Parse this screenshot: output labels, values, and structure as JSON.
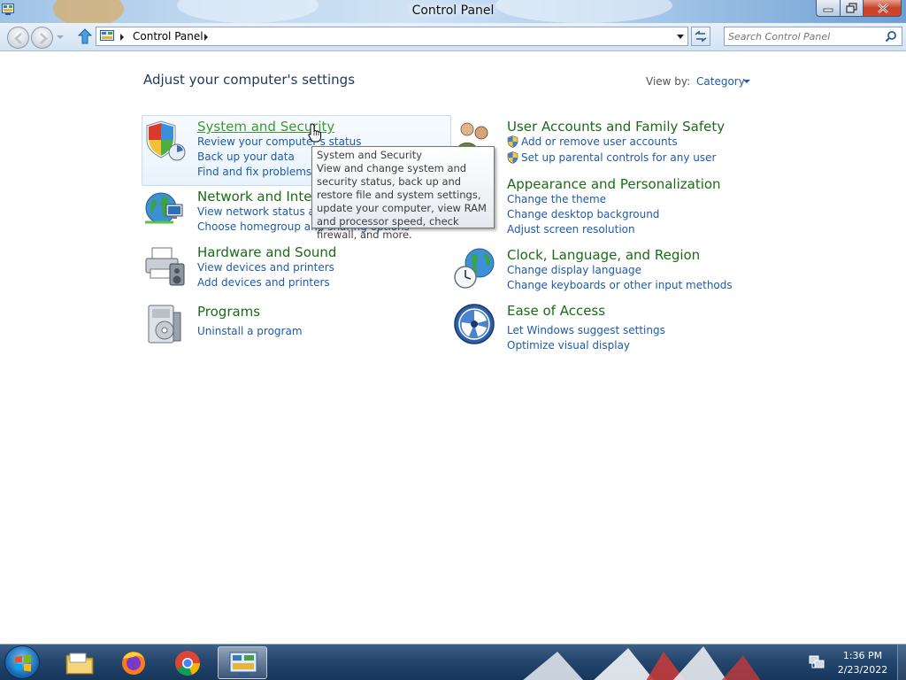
{
  "window": {
    "title": "Control Panel"
  },
  "address": {
    "breadcrumb": "Control Panel",
    "search_placeholder": "Search Control Panel"
  },
  "main": {
    "heading": "Adjust your computer's settings",
    "view_by_label": "View by:",
    "view_by_value": "Category",
    "categories": [
      {
        "title": "System and Security",
        "icon": "shield-icon",
        "links": [
          "Review your computer's status",
          "Back up your data",
          "Find and fix problems"
        ]
      },
      {
        "title": "Network and Internet",
        "icon": "network-globe-icon",
        "links": [
          "View network status and tasks",
          "Choose homegroup and sharing options"
        ]
      },
      {
        "title": "Hardware and Sound",
        "icon": "printer-speaker-icon",
        "links": [
          "View devices and printers",
          "Add devices and printers"
        ]
      },
      {
        "title": "Programs",
        "icon": "programs-icon",
        "links": [
          "Uninstall a program"
        ]
      },
      {
        "title": "User Accounts and Family Safety",
        "icon": "users-icon",
        "links": [
          "Add or remove user accounts",
          "Set up parental controls for any user"
        ]
      },
      {
        "title": "Appearance and Personalization",
        "icon": "appearance-icon",
        "links": [
          "Change the theme",
          "Change desktop background",
          "Adjust screen resolution"
        ]
      },
      {
        "title": "Clock, Language, and Region",
        "icon": "clock-globe-icon",
        "links": [
          "Change display language",
          "Change keyboards or other input methods"
        ]
      },
      {
        "title": "Ease of Access",
        "icon": "ease-of-access-icon",
        "links": [
          "Let Windows suggest settings",
          "Optimize visual display"
        ]
      }
    ]
  },
  "tooltip": {
    "title": "System and Security",
    "body": "View and change system and security status, back up and restore file and system settings, update your computer, view RAM and processor speed, check firewall, and more."
  },
  "taskbar": {
    "items": [
      "start-orb-icon",
      "file-explorer-icon",
      "firefox-icon",
      "chrome-icon",
      "control-panel-icon"
    ],
    "time": "1:36 PM",
    "date": "2/23/2022"
  },
  "colors": {
    "category_title": "#1a6b16",
    "link": "#1e5ba8",
    "heading": "#1e395b"
  }
}
